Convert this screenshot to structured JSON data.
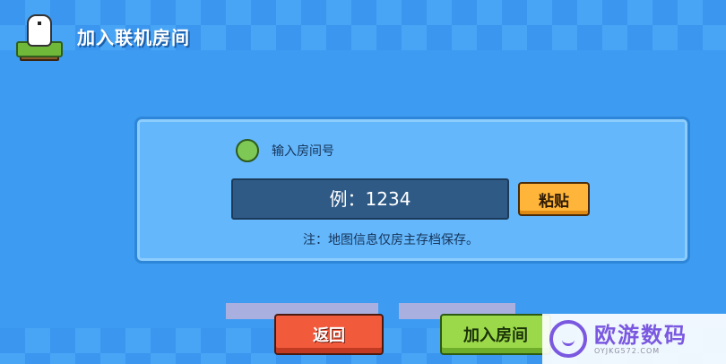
{
  "header": {
    "title": "加入联机房间"
  },
  "panel": {
    "label": "输入房间号",
    "input_placeholder": "例：1234",
    "paste_label": "粘贴",
    "note": "注：地图信息仅房主存档保存。"
  },
  "footer": {
    "back_label": "返回",
    "join_label": "加入房间"
  },
  "watermark": {
    "title": "欧游数码",
    "url": "OYJKG572.COM"
  },
  "colors": {
    "background": "#3d9cf2",
    "panel": "#64b7fb",
    "input": "#2f5a86",
    "paste_button": "#ffb53a",
    "back_button": "#f25a3c",
    "join_button": "#9bd84a",
    "watermark_accent": "#7a58e0"
  },
  "icons": {
    "logo": "dinosaur-grass-icon",
    "label_marker": "green-dot-icon"
  }
}
